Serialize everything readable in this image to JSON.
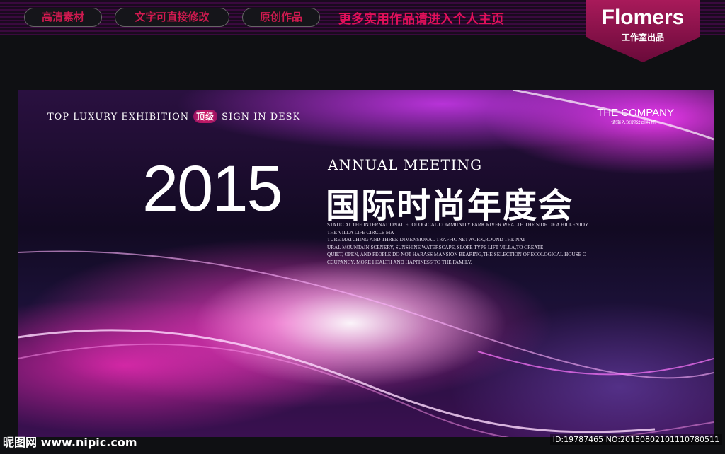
{
  "header": {
    "buttons": [
      "高清素材",
      "文字可直接修改",
      "原创作品"
    ],
    "promo": "更多实用作品请进入个人主页",
    "badge_title": "Flomers",
    "badge_sub": "工作室出品"
  },
  "banner": {
    "top_left_1": "TOP LUXURY EXHIBITION",
    "tag": "顶级",
    "top_left_2": "SIGN IN DESK",
    "company": "THE COMPANY",
    "company_sub": "请输入您的公司名称",
    "year": "2015",
    "annual": "ANNUAL MEETING",
    "title_cn": "国际时尚年度会",
    "paragraph": [
      "STATIC AT THE INTERNATIONAL ECOLOGICAL COMMUNITY PARK RIVER WEALTH THE SIDE OF A HILLENJOY",
      "THE VILLA LIFE CIRCLE MA",
      "TURE MATCHING AND THREE-DIMENSIONAL TRAFFIC NETWORK,ROUND THE NAT",
      "URAL MOUNTAIN SCENERY, SUNSHINE WATERSCAPE, SLOPE TYPE LIFT VILLA,TO CREATE",
      "QUIET, OPEN, AND PEOPLE DO NOT HARASS MANSION BEARING,THE SELECTION OF ECOLOGICAL HOUSE O",
      "CCUPANCY, MORE HEALTH AND HAPPINESS TO THE FAMILY."
    ]
  },
  "watermark": {
    "left": "昵图网 www.nipic.com",
    "right": "ID:19787465 NO:20150802101110780511"
  }
}
